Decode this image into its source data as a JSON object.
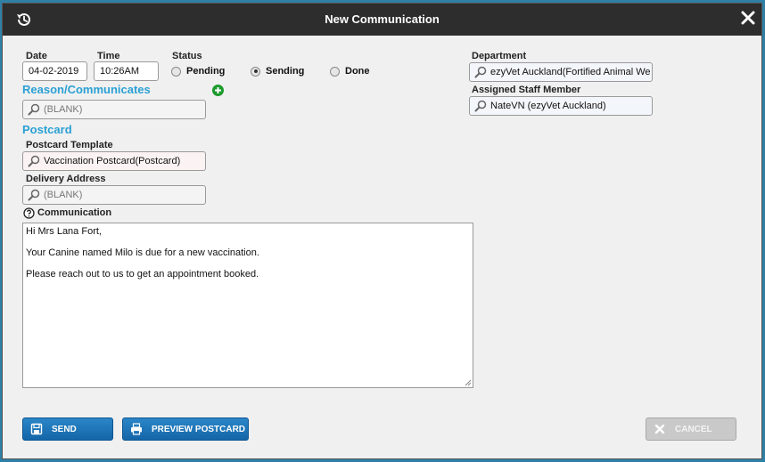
{
  "dialog": {
    "title": "New Communication"
  },
  "form": {
    "date_label": "Date",
    "date_value": "04-02-2019",
    "time_label": "Time",
    "time_value": "10:26AM",
    "status_label": "Status",
    "status_options": [
      "Pending",
      "Sending",
      "Done"
    ],
    "status_selected": "Sending",
    "department_label": "Department",
    "department_value": "ezyVet Auckland(Fortified Animal We",
    "assigned_label": "Assigned Staff Member",
    "assigned_value": "NateVN (ezyVet Auckland)",
    "reason_heading": "Reason/Communicates",
    "reason_value": "(BLANK)",
    "postcard_heading": "Postcard",
    "template_label": "Postcard Template",
    "template_value": "Vaccination Postcard(Postcard)",
    "delivery_label": "Delivery Address",
    "delivery_value": "(BLANK)",
    "communication_label": "Communication",
    "communication_lines": [
      "Hi Mrs Lana Fort,",
      "Your Canine named Milo is due for a new vaccination.",
      "Please reach out to us to get an appointment booked."
    ]
  },
  "buttons": {
    "send": "SEND",
    "preview": "PREVIEW POSTCARD",
    "cancel": "CANCEL"
  },
  "icons": {
    "history": "history-icon",
    "close": "close-icon",
    "search": "search-icon",
    "add": "add-icon",
    "help": "help-icon",
    "save": "save-icon",
    "print": "print-icon",
    "cancel": "cancel-x-icon"
  },
  "colors": {
    "accent": "#2aa0d4",
    "primary_button": "#1c74b8",
    "titlebar": "#2d2d2d",
    "add_green": "#1c9a2c"
  }
}
